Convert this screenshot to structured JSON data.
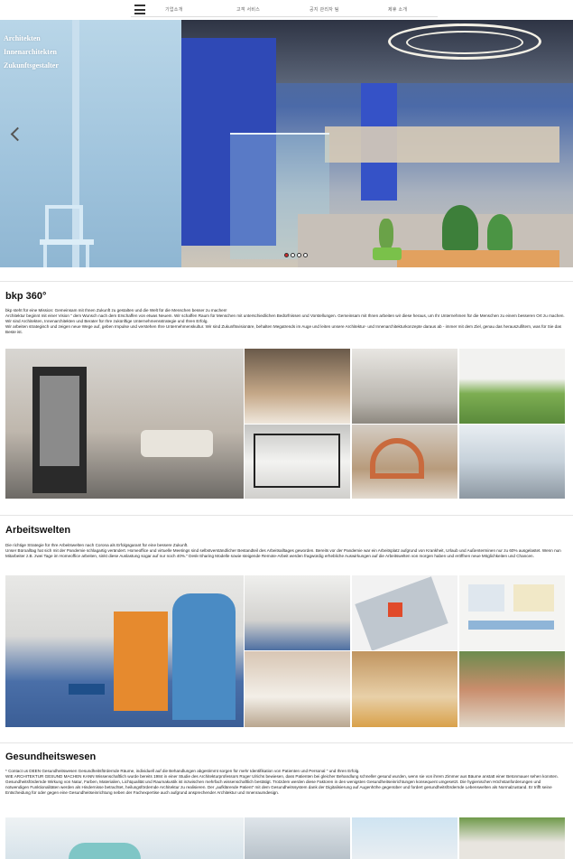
{
  "nav": {
    "items": [
      "기업소개",
      "고객 서비스",
      "공지 관리자 팀",
      "제휴 소개"
    ]
  },
  "hero": {
    "caption": [
      "Architekten",
      "Innenarchitekten",
      "Zukunftsgestalter"
    ],
    "slides_total": 4,
    "slide_active": 1
  },
  "sections": [
    {
      "title": "bkp 360°",
      "paragraphs": [
        "bkp steht für eine Mission: Gemeinsam mit Ihnen Zukunft zu gestalten und die Welt für die Menschen besser zu machen!",
        "Architektur beginnt mit einer Vision \" dem Wunsch nach dem Erschaffen von etwas Neuem. Wir schaffen Raum für Menschen mit unterschiedlichen Bedürfnissen und Vorstellungen. Gemeinsam mit Ihnen arbeiten wir diese heraus, um Ihr Unternehmen für die Menschen zu einem besseren Ort zu machen. Wir sind Architekten, Innenarchitekten und Berater für Ihre zukünftige Unternehmensstrategie und Ihren Erfolg.",
        "Wir arbeiten strategisch und zeigen neue Wege auf, geben Impulse und verstehen Ihre Unternehmenskultur. Wir sind Zukunftsvisionäre, behalten Megatrends im Auge und leiten unsere Architektur- und Innenarchitekturkonzepte daraus ab - immer mit dem Ziel, genau das herauszufiltern, was für Sie das Beste ist."
      ]
    },
    {
      "title": "Arbeitswelten",
      "paragraphs": [
        "Die richtige Strategie für Ihre Arbeitswelten nach Corona als Erfolgsgarant für eine bessere Zukunft.",
        "Unser Büroalltag hat sich mit der Pandemie schlagartig verändert. Homeoffice und virtuelle Meetings sind selbstverständlicher Bestandteil des Arbeitsalltages geworden. Bereits vor der Pandemie war ein Arbeitsplatz aufgrund von Krankheit, Urlaub und Außenterminen nur zu 60% ausgelastet. Wenn nun Mitarbeiter z.B. zwei Tage im Homeoffice arbeiten, sinkt diese Auslastung sogar auf nur noch 40%.\" Desk-Sharing Modelle sowie steigende Remote-Arbeit werden fragwürdig erhebliche Auswirkungen auf die Arbeitswelten von morgen haben und eröffnen neue Möglichkeiten und Chancen."
      ]
    },
    {
      "title": "Gesundheitswesen",
      "paragraphs": [
        "* Contact us DEEN Gesundheitswesen Gesundheitsfördernde Räume, individuell auf die Behandlungen abgestimmt sorgen für mehr Identifikation von Patienten und Personal \" und Ihren Erfolg.",
        "WIE ARCHITEKTUR GESUND MACHEN KANN Wissenschaftlich wurde bereits 1984 in einer Studie des Architekturprofessors Roger Ulrichs bewiesen, dass Patienten bei gleicher Behandlung schneller gesund wurden, wenn sie von ihrem Zimmer aus Bäume anstatt einer Betonmauer sehen konnten. Gesundheitsfördernde Wirkung von Natur, Farben, Materialien, Lichtqualität und Raumakustik ist inzwischen mehrfach wissenschaftlich bestätigt. Trotzdem werden diese Faktoren in den wenigsten Gesundheitseinrichtungen konsequent umgesetzt. Die hygienischen Höchstanforderungen und notwendigen Funktionalitäten werden als Hindernisse betrachtet, heilungsfördernde Architektur zu realisieren. Der „aufklärende Patient“ mit dem Gesundheitssystem dank der Digitalisierung auf Augenhöhe gegenüber und fordert gesundheitsfördernde Lebenswelten als Normalzustand. Er trifft seine Entscheidung für oder gegen eine Gesundheitseinrichtung neben der Fachexpertise auch aufgrund ansprechender Architektur und Innenraumdesign."
      ]
    }
  ],
  "colors": {
    "accent_dot": "#d12b2b",
    "divider": "#e4e4e4",
    "hero_blue": "#2f49b6"
  }
}
